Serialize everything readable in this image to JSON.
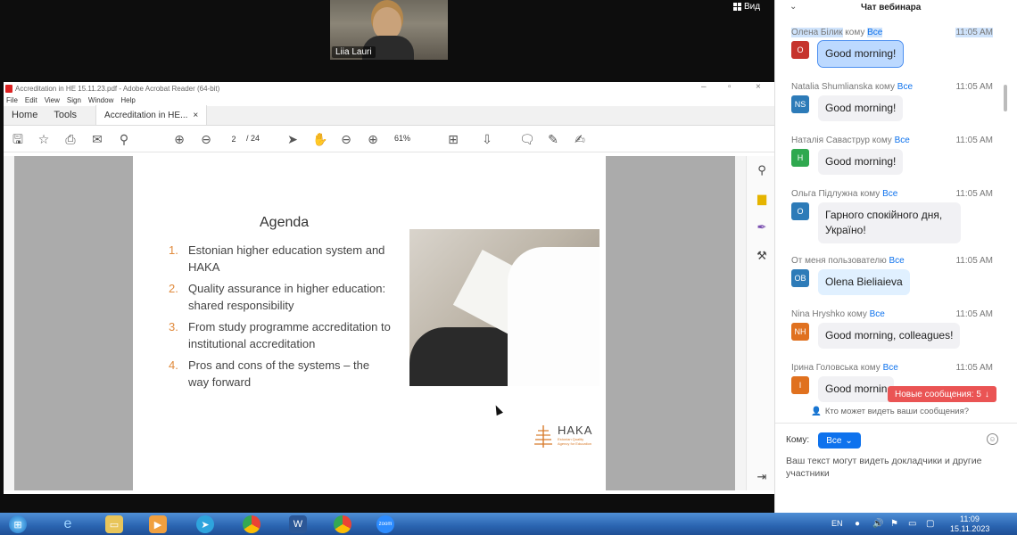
{
  "meeting": {
    "participant_name": "Liia Lauri",
    "view_label": "Вид"
  },
  "acrobat": {
    "window_title": "Accreditation in HE 15.11.23.pdf - Adobe Acrobat Reader (64-bit)",
    "menu": [
      "File",
      "Edit",
      "View",
      "Sign",
      "Window",
      "Help"
    ],
    "tabs": {
      "home": "Home",
      "tools": "Tools",
      "doc": "Accreditation in HE...",
      "close": "×"
    },
    "page_current": "2",
    "page_count": "/ 24",
    "zoom": "61%"
  },
  "slide": {
    "title": "Agenda",
    "items": [
      {
        "num": "1.",
        "text": "Estonian higher education system and HAKA"
      },
      {
        "num": "2.",
        "text": "Quality assurance in  higher education: shared responsibility"
      },
      {
        "num": "3.",
        "text": "From study programme accreditation to institutional accreditation"
      },
      {
        "num": "4.",
        "text": "Pros and cons of the systems – the way forward"
      }
    ],
    "logo_word": "HAKA",
    "logo_sub": "Estonian Quality Agency for Education"
  },
  "chat": {
    "title": "Чат вебинара",
    "to_word": "кому",
    "messages": [
      {
        "sender": "Олена Білик",
        "to": "кому",
        "target": "Все",
        "time": "11:05 AM",
        "initials": "O",
        "color": "#c6342d",
        "text": "Good morning!"
      },
      {
        "sender": "Natalia Shumlianska",
        "to": "кому",
        "target": "Все",
        "time": "11:05 AM",
        "initials": "NS",
        "color": "#2d7bb8",
        "text": "Good morning!"
      },
      {
        "sender": "Наталія Саваструр",
        "to": "кому",
        "target": "Все",
        "time": "11:05 AM",
        "initials": "Н",
        "color": "#2fa84f",
        "text": "Good morning!"
      },
      {
        "sender": "Ольга Підлужна",
        "to": "кому",
        "target": "Все",
        "time": "11:05 AM",
        "initials": "О",
        "color": "#2d7bb8",
        "text": "Гарного спокійного дня, Україно!"
      },
      {
        "sender": "От меня",
        "to": "пользователю",
        "target": "Все",
        "time": "11:05 AM",
        "initials": "OB",
        "color": "#2d7bb8",
        "text": "Olena Bieliaieva"
      },
      {
        "sender": "Nina Hryshko",
        "to": "кому",
        "target": "Все",
        "time": "11:05 AM",
        "initials": "NH",
        "color": "#e0711f",
        "text": "Good morning, colleagues!"
      },
      {
        "sender": "Ірина Головська",
        "to": "кому",
        "target": "Все",
        "time": "11:05 AM",
        "initials": "І",
        "color": "#e0711f",
        "text": "Good mornin"
      }
    ],
    "new_messages": "Новые сообщения: 5",
    "who_sees": "Кто может видеть ваши сообщения?",
    "to_label": "Кому:",
    "to_value": "Все",
    "input_hint": "Ваш текст могут видеть докладчики и другие участники"
  },
  "taskbar": {
    "lang": "EN",
    "time": "11:09",
    "date": "15.11.2023"
  }
}
